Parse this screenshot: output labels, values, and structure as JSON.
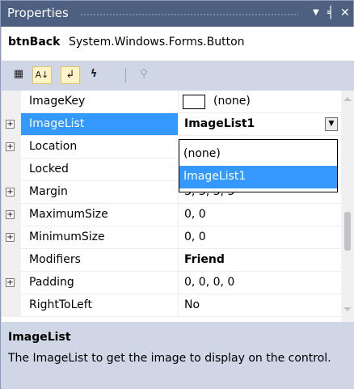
{
  "title": "Properties",
  "object": {
    "name": "btnBack",
    "type": "System.Windows.Forms.Button"
  },
  "toolbar": {
    "buttons": [
      {
        "icon": "categorized-icon",
        "glyph": "▦"
      },
      {
        "icon": "alphabetical-icon",
        "glyph": "A↓"
      },
      {
        "icon": "properties-icon",
        "glyph": "↲"
      },
      {
        "icon": "events-icon",
        "glyph": "ϟ"
      },
      {
        "icon": "property-pages-icon",
        "glyph": "⚲"
      }
    ]
  },
  "rows": [
    {
      "name": "ImageKey",
      "value": "(none)"
    },
    {
      "name": "ImageList",
      "value": "ImageList1"
    },
    {
      "name": "Location",
      "value": ""
    },
    {
      "name": "Locked",
      "value": ""
    },
    {
      "name": "Margin",
      "value": "3, 3, 3, 3"
    },
    {
      "name": "MaximumSize",
      "value": "0, 0"
    },
    {
      "name": "MinimumSize",
      "value": "0, 0"
    },
    {
      "name": "Modifiers",
      "value": "Friend"
    },
    {
      "name": "Padding",
      "value": "0, 0, 0, 0"
    },
    {
      "name": "RightToLeft",
      "value": "No"
    }
  ],
  "dropdown": {
    "options": [
      "(none)",
      "ImageList1"
    ],
    "selected": "ImageList1"
  },
  "description": {
    "heading": "ImageList",
    "text": "The ImageList to get the image to display on the control."
  },
  "colors": {
    "titlebar": "#4d6082",
    "selection": "#3399ff",
    "panel": "#cfd6e5"
  }
}
